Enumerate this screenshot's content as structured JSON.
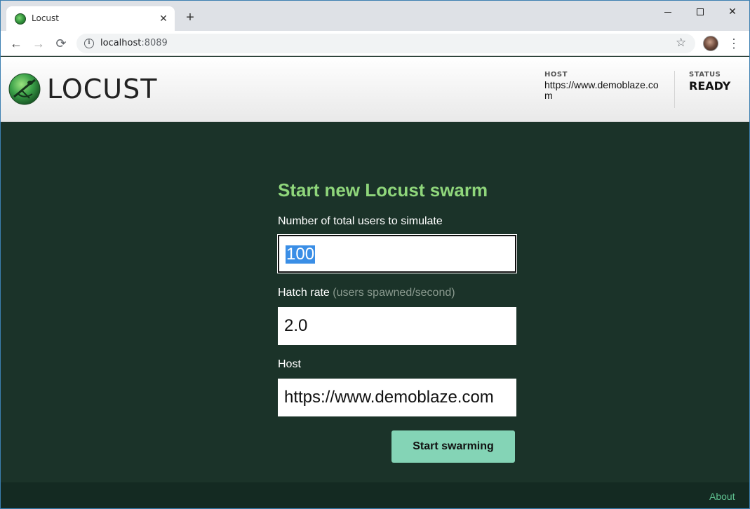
{
  "browser": {
    "tab_title": "Locust",
    "tab_close": "✕",
    "new_tab": "+",
    "url_host": "localhost",
    "url_port": ":8089"
  },
  "header": {
    "logo_text": "LOCUST",
    "host_label": "HOST",
    "host_value": "https://www.demoblaze.com",
    "status_label": "STATUS",
    "status_value": "READY"
  },
  "form": {
    "title": "Start new Locust swarm",
    "users_label": "Number of total users to simulate",
    "users_value": "100",
    "hatch_label": "Hatch rate",
    "hatch_hint": "(users spawned/second)",
    "hatch_value": "2.0",
    "host_label": "Host",
    "host_value": "https://www.demoblaze.com",
    "submit_label": "Start swarming"
  },
  "footer": {
    "about_label": "About"
  },
  "colors": {
    "page_bg": "#1b3329",
    "title_green": "#8fd67b",
    "button_bg": "#84d4b6",
    "link_green": "#5ec08f"
  }
}
